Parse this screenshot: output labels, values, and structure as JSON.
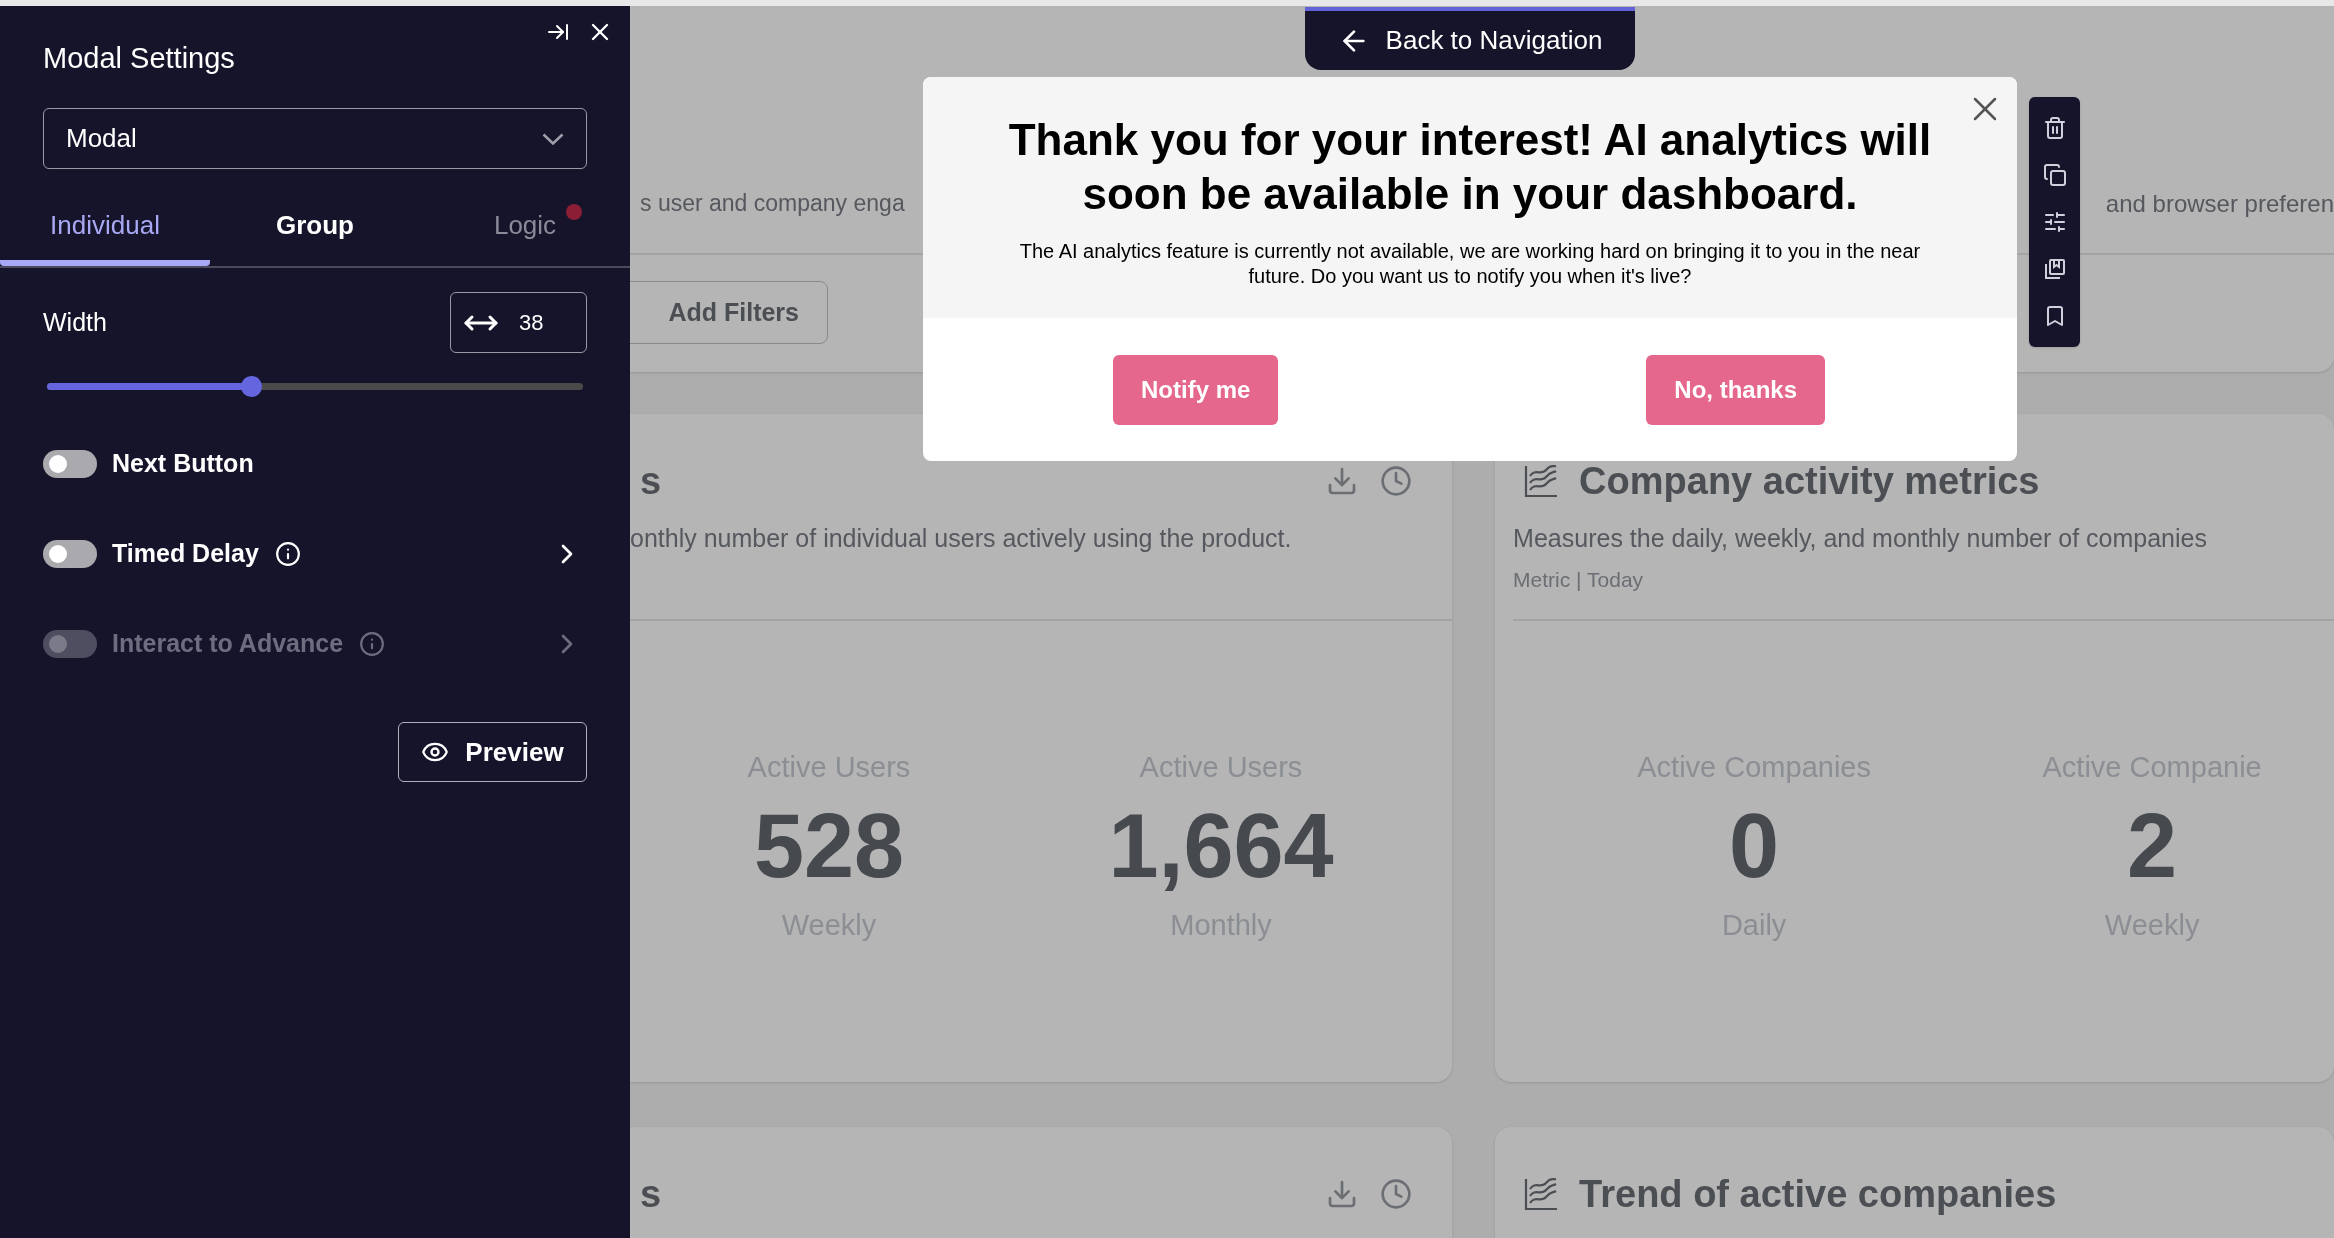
{
  "panel": {
    "title": "Modal Settings",
    "select": {
      "value": "Modal"
    },
    "tabs": [
      {
        "label": "Individual",
        "selected": true,
        "dimmed": false,
        "alert": false
      },
      {
        "label": "Group",
        "selected": false,
        "dimmed": false,
        "alert": false
      },
      {
        "label": "Logic",
        "selected": false,
        "dimmed": true,
        "alert": true
      }
    ],
    "width": {
      "label": "Width",
      "value": "38",
      "level": 0.38
    },
    "toggles": [
      {
        "label": "Next Button",
        "on": false,
        "disabled": false,
        "info": false,
        "submenu": false
      },
      {
        "label": "Timed Delay",
        "on": false,
        "disabled": false,
        "info": true,
        "submenu": true
      },
      {
        "label": "Interact to Advance",
        "on": false,
        "disabled": true,
        "info": true,
        "submenu": true
      }
    ],
    "preview_button": "Preview"
  },
  "back_button": "Back to Navigation",
  "top_card": {
    "description_left": "s user and company enga",
    "description_right": "and browser preferen",
    "filter_button": "Add Filters"
  },
  "cards": [
    {
      "kind": "export",
      "title": "s",
      "description": "onthly number of individual users actively using the product.",
      "stats": [
        {
          "label": "Active Users",
          "value": "528",
          "period": "Weekly"
        },
        {
          "label": "Active Users",
          "value": "1,664",
          "period": "Monthly"
        }
      ]
    },
    {
      "kind": "chart",
      "title": "Company activity metrics",
      "description": "Measures the daily, weekly, and monthly number of companies",
      "meta": "Metric | Today",
      "stats": [
        {
          "label": "Active Companies",
          "value": "0",
          "period": "Daily"
        },
        {
          "label": "Active Companie",
          "value": "2",
          "period": "Weekly"
        }
      ]
    },
    {
      "kind": "export",
      "title": "s"
    },
    {
      "kind": "chart",
      "title": "Trend of active companies"
    }
  ],
  "modal": {
    "title": "Thank you for your interest! AI analytics will soon be available in your dashboard.",
    "body": "The AI analytics feature is currently not available, we are working hard on bringing it to you in the near future. Do you want us to notify you when it's live?",
    "buttons": [
      "Notify me",
      "No, thanks"
    ]
  }
}
